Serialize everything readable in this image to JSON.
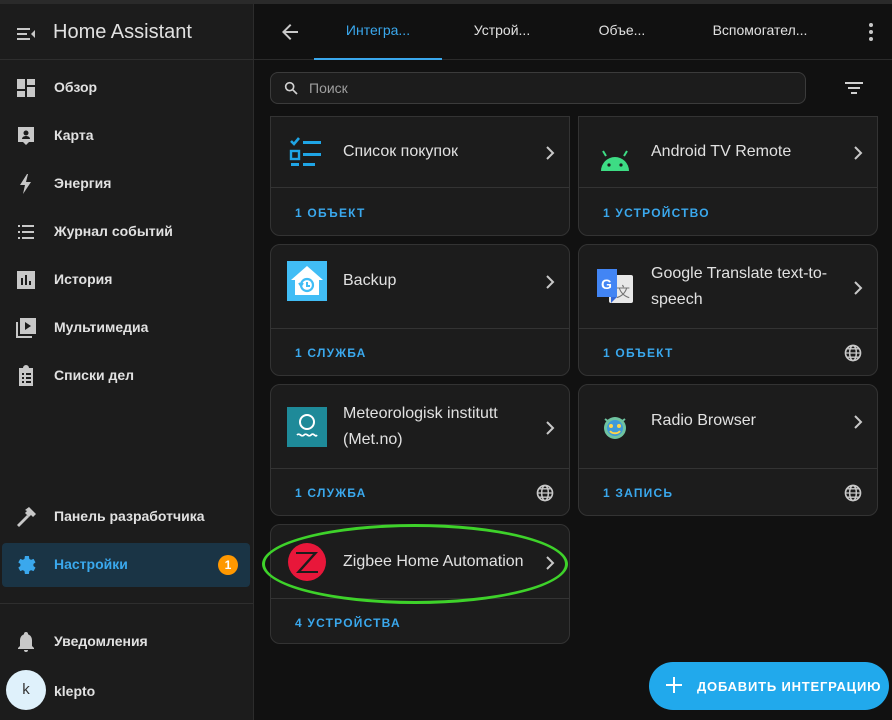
{
  "app": {
    "title": "Home Assistant"
  },
  "sidebar": {
    "items": [
      {
        "label": "Обзор",
        "icon": "dashboard-icon"
      },
      {
        "label": "Карта",
        "icon": "map-icon"
      },
      {
        "label": "Энергия",
        "icon": "lightning-icon"
      },
      {
        "label": "Журнал событий",
        "icon": "logbook-icon"
      },
      {
        "label": "История",
        "icon": "history-chart-icon"
      },
      {
        "label": "Мультимедиа",
        "icon": "media-icon"
      },
      {
        "label": "Списки дел",
        "icon": "todo-clipboard-icon"
      }
    ],
    "developer": {
      "label": "Панель разработчика",
      "icon": "hammer-icon"
    },
    "settings": {
      "label": "Настройки",
      "icon": "gear-icon",
      "badge": "1"
    },
    "notifications": {
      "label": "Уведомления",
      "icon": "bell-icon"
    },
    "user": {
      "initial": "k",
      "name": "klepto"
    }
  },
  "tabs": [
    {
      "label": "Интегра...",
      "active": true
    },
    {
      "label": "Устрой...",
      "active": false
    },
    {
      "label": "Объе...",
      "active": false
    },
    {
      "label": "Вспомогател...",
      "active": false
    }
  ],
  "search": {
    "placeholder": "Поиск",
    "value": ""
  },
  "integrations": [
    {
      "name": "Список покупок",
      "footer": "1 ОБЪЕКТ",
      "icon": "shopping-list-icon",
      "cloud": false
    },
    {
      "name": "Android TV Remote",
      "footer": "1 УСТРОЙСТВО",
      "icon": "android-icon",
      "cloud": false
    },
    {
      "name": "Backup",
      "footer": "1 СЛУЖБА",
      "icon": "backup-house-icon",
      "cloud": false
    },
    {
      "name": "Google Translate text-to-speech",
      "footer": "1 ОБЪЕКТ",
      "icon": "google-translate-icon",
      "cloud": true
    },
    {
      "name": "Meteorologisk institutt (Met.no)",
      "footer": "1 СЛУЖБА",
      "icon": "met-no-icon",
      "cloud": true
    },
    {
      "name": "Radio Browser",
      "footer": "1 ЗАПИСЬ",
      "icon": "radio-browser-icon",
      "cloud": true
    },
    {
      "name": "Zigbee Home Automation",
      "footer": "4 УСТРОЙСТВА",
      "icon": "zigbee-icon",
      "cloud": false
    }
  ],
  "fab": {
    "label": "ДОБАВИТЬ ИНТЕГРАЦИЮ",
    "icon": "plus-icon"
  },
  "colors": {
    "accent": "#3aa8ed",
    "badge": "#ff9800",
    "highlight": "#3ed22a",
    "fab": "#21a9ec"
  }
}
